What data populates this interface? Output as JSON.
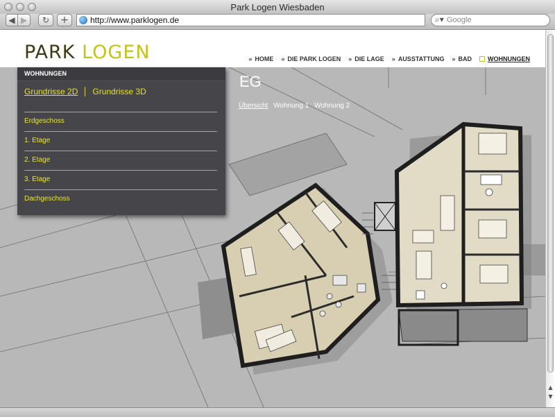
{
  "browser": {
    "window_title": "Park Logen Wiesbaden",
    "url": "http://www.parklogen.de",
    "search_placeholder": "Google",
    "back_icon": "back-arrow-icon",
    "forward_icon": "forward-arrow-icon",
    "reload_icon": "reload-icon",
    "add_icon": "plus-icon"
  },
  "site": {
    "logo_part1": "PARK",
    "logo_part2": "LOGEN",
    "colors": {
      "accent": "#c6c317",
      "dark_olive": "#3d3a13",
      "panel": "#46464a"
    },
    "nav": [
      {
        "label": "HOME",
        "active": false
      },
      {
        "label": "DIE PARK LOGEN",
        "active": false
      },
      {
        "label": "DIE LAGE",
        "active": false
      },
      {
        "label": "AUSSTATTUNG",
        "active": false
      },
      {
        "label": "BAD",
        "active": false
      },
      {
        "label": "WOHNUNGEN",
        "active": true
      }
    ]
  },
  "panel": {
    "heading": "WOHNUNGEN",
    "tabs": [
      "Grundrisse 2D",
      "Grundrisse 3D"
    ],
    "floors": [
      "Erdgeschoss",
      "1. Etage",
      "2. Etage",
      "3. Etage",
      "Dachgeschoss"
    ]
  },
  "floorplan": {
    "title": "EG",
    "links": [
      "Übersicht",
      "Wohnung 1",
      "Wohnung 2"
    ]
  }
}
